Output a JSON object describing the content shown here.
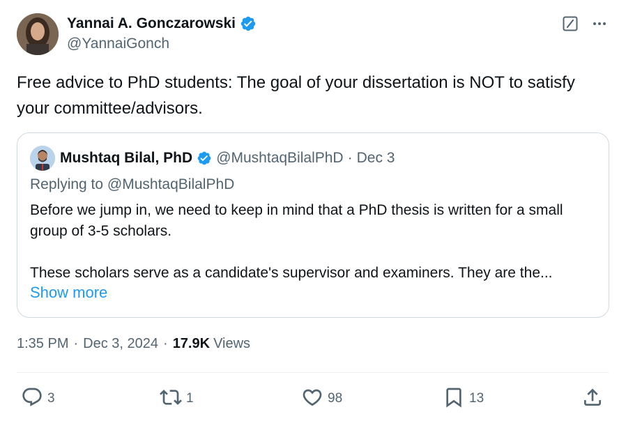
{
  "author": {
    "name": "Yannai A. Gonczarowski",
    "handle": "@YannaiGonch",
    "verified": true
  },
  "tweet": {
    "text": "Free advice to PhD students: The goal of your dissertation is NOT to satisfy your committee/advisors."
  },
  "quoted": {
    "name": "Mushtaq Bilal, PhD",
    "handle": "@MushtaqBilalPhD",
    "dot": "·",
    "date": "Dec 3",
    "replying_prefix": "Replying to ",
    "replying_handle": "@MushtaqBilalPhD",
    "para1": "Before we jump in, we need to keep in mind that a PhD thesis is written for a small group of 3-5 scholars.",
    "para2": "These scholars serve as a candidate's supervisor and examiners. They are the...",
    "show_more": "Show more"
  },
  "meta": {
    "time": "1:35 PM",
    "sep1": "·",
    "date": "Dec 3, 2024",
    "sep2": "·",
    "views_count": "17.9K",
    "views_label": "Views"
  },
  "actions": {
    "replies": "3",
    "reposts": "1",
    "likes": "98",
    "bookmarks": "13"
  },
  "colors": {
    "verified": "#1d9bf0",
    "link": "#1d9bf0",
    "secondary_text": "#536471",
    "primary_text": "#0f1419"
  },
  "icons": {
    "verified": "verified-badge-icon",
    "grok": "grok-icon",
    "more": "more-icon",
    "reply": "reply-icon",
    "repost": "repost-icon",
    "like": "heart-icon",
    "bookmark": "bookmark-icon",
    "share": "share-icon"
  }
}
